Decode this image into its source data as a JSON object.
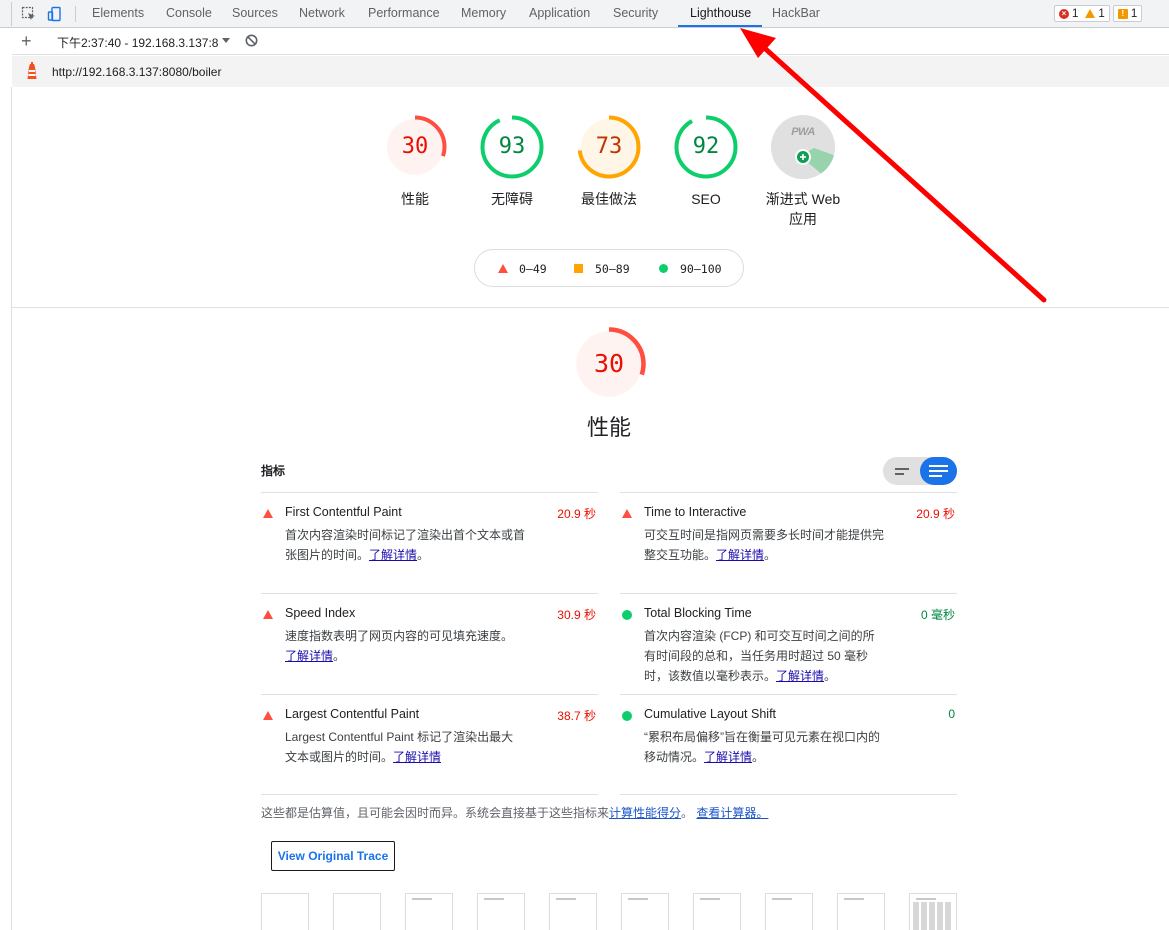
{
  "devtools": {
    "tabs": [
      {
        "label": "Elements"
      },
      {
        "label": "Console"
      },
      {
        "label": "Sources"
      },
      {
        "label": "Network"
      },
      {
        "label": "Performance"
      },
      {
        "label": "Memory"
      },
      {
        "label": "Application"
      },
      {
        "label": "Security"
      },
      {
        "label": "Lighthouse",
        "active": true
      },
      {
        "label": "HackBar"
      }
    ],
    "counters": {
      "errors": "1",
      "warnings": "1",
      "issues": "1"
    },
    "icons": [
      "inspect-icon",
      "device-toggle-icon"
    ]
  },
  "report_bar": {
    "selected_report": "下午2:37:40 - 192.168.3.137:8",
    "add_icon": "plus-icon",
    "clear_icon": "block-icon"
  },
  "url_bar": {
    "url": "http://192.168.3.137:8080/boiler"
  },
  "gauges": [
    {
      "score": "30",
      "label": "性能",
      "value": 30,
      "color": "#ff4e42",
      "bg": "#fff3f2",
      "text": "#eb0f00"
    },
    {
      "score": "93",
      "label": "无障碍",
      "value": 93,
      "color": "#0cce6b",
      "bg": "#ffffff",
      "text": "#018642"
    },
    {
      "score": "73",
      "label": "最佳做法",
      "value": 73,
      "color": "#ffa400",
      "bg": "#fff6e8",
      "text": "#c33300"
    },
    {
      "score": "92",
      "label": "SEO",
      "value": 92,
      "color": "#0cce6b",
      "bg": "#ffffff",
      "text": "#018642"
    }
  ],
  "pwa": {
    "badge_text": "PWA",
    "label_line1": "渐进式 Web",
    "label_line2": "应用"
  },
  "legend": {
    "fail": "0–49",
    "average": "50–89",
    "pass": "90–100"
  },
  "performance": {
    "score": "30",
    "score_value": 30,
    "title": "性能",
    "metrics_heading": "指标",
    "metrics": [
      {
        "title": "First Contentful Paint",
        "value": "20.9 秒",
        "status": "fail",
        "desc": "首次内容渲染时间标记了渲染出首个文本或首张图片的时间。",
        "link": "了解详情",
        "after": "。"
      },
      {
        "title": "Time to Interactive",
        "value": "20.9 秒",
        "status": "fail",
        "desc": "可交互时间是指网页需要多长时间才能提供完整交互功能。",
        "link": "了解详情",
        "after": "。"
      },
      {
        "title": "Speed Index",
        "value": "30.9 秒",
        "status": "fail",
        "desc": "速度指数表明了网页内容的可见填充速度。",
        "link": "了解详情",
        "after": "。"
      },
      {
        "title": "Total Blocking Time",
        "value": "0 毫秒",
        "status": "pass",
        "desc": "首次内容渲染 (FCP) 和可交互时间之间的所有时间段的总和，当任务用时超过 50 毫秒时，该数值以毫秒表示。",
        "link": "了解详情",
        "after": "。"
      },
      {
        "title": "Largest Contentful Paint",
        "value": "38.7 秒",
        "status": "fail",
        "desc": "Largest Contentful Paint 标记了渲染出最大文本或图片的时间。",
        "link": "了解详情",
        "after": ""
      },
      {
        "title": "Cumulative Layout Shift",
        "value": "0",
        "status": "pass",
        "desc": "“累积布局偏移”旨在衡量可见元素在视口内的移动情况。",
        "link": "了解详情",
        "after": "。"
      }
    ],
    "footnote_text": "这些都是估算值，且可能会因时而异。系统会直接基于这些指标来",
    "footnote_link1": "计算性能得分",
    "footnote_mid": "。",
    "footnote_link2": "查看计算器。",
    "view_trace_label": "View Original Trace"
  },
  "annotation_arrow_color": "#ff0000"
}
